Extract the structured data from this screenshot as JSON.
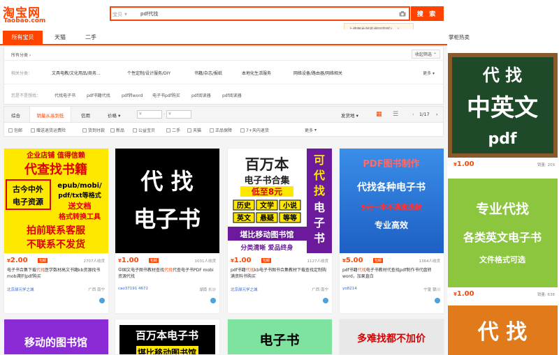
{
  "header": {
    "logo_cn": "淘宝网",
    "logo_en": "Taobao.com",
    "search_scope": "宝贝",
    "search_query": "pdf代找",
    "search_button": "搜 索",
    "tip": "上传图片就能搜同款啦!"
  },
  "tabs": [
    "所有宝贝",
    "天猫",
    "二手"
  ],
  "filters": {
    "all_categories": "所有分类",
    "collapse": "收起筛选",
    "category_label": "相关分类：",
    "categories": [
      "文具电教/文化用品/商务...",
      "个性定制/设计服务/DIY",
      "书籍/杂志/报纸",
      "本地化生活服务",
      "网络设备/路由器/网络相关"
    ],
    "more": "更多",
    "guess_label": "您是不是想找：",
    "guesses": [
      "代找电子书",
      "pdf书籍代找",
      "pdf转word",
      "电子书pdf购买",
      "pdf阅读器",
      "pdf阅读器"
    ]
  },
  "sort": {
    "options": [
      "综合",
      "销量从高到低",
      "信用",
      "价格"
    ],
    "price_from": "¥",
    "price_to": "¥",
    "ship_from": "发货地",
    "page": "1/17"
  },
  "checks": [
    "包邮",
    "赠送退货运费险",
    "货到付款",
    "新品",
    "公益宝贝",
    "二手",
    "天猫",
    "正品保障",
    "7+天内退货"
  ],
  "checks_more": "更多",
  "products": [
    {
      "img_lines": [
        "企业店铺 值得信赖",
        "代查找书籍",
        "古今中外",
        "电子资源",
        "epub/mobi/",
        "pdf/txt等格式",
        "送文档",
        "格式转换工具",
        "拍前联系客服",
        "不联系不发货"
      ],
      "price": "2.00",
      "badge": "包邮",
      "sold": "2707人收货",
      "title_pre": "电子书合集下载",
      "title_hl": "代找",
      "title_post": "医学数材高文书籍kb资源找书mobi期刊pdf购买",
      "shop": "北京颉元学之城",
      "loc": "广西 南宁"
    },
    {
      "img_lines": [
        "代 找",
        "电子书"
      ],
      "price": "1.00",
      "badge": "包邮",
      "sold": "1031人收货",
      "title_pre": "中国文电子图书教材查找",
      "title_hl": "代找",
      "title_post": "代查电子书PDF mobi资源代找",
      "shop": "cao37191 4672",
      "loc": "湖南 长沙"
    },
    {
      "img_lines": [
        "百万本",
        "电子书合集",
        "低至8元",
        "历史",
        "文学",
        "小说",
        "英文",
        "悬疑",
        "等等",
        "堪比移动图书馆",
        "分类清晰 爱品终身",
        "可",
        "代",
        "找",
        "电",
        "子",
        "书"
      ],
      "price": "1.00",
      "badge": "包邮",
      "sold": "1127人收货",
      "title_pre": "pdf书籍",
      "title_hl": "代找",
      "title_post": "kb电子书图书合集教材下载查找定制购满资料书购买",
      "shop": "北京颉元学之城",
      "loc": "广西 南宁"
    },
    {
      "img_lines": [
        "PDF图书制作",
        "代找各种电子书",
        "5元一本不满意退款",
        "专业高效"
      ],
      "price": "5.00",
      "badge": "包邮",
      "sold": "1364人收货",
      "title_pre": "pdf书籍",
      "title_hl": "代找",
      "title_post": "电子书教材代查找pdf制作书代盘转word，加果直白",
      "shop": "yo8214",
      "loc": "宁夏 银川"
    }
  ],
  "row2": [
    {
      "text": "移动的图书馆"
    },
    {
      "text": "百万本电子书",
      "sub": "堪比移动图书馆"
    },
    {
      "text": "电子书"
    },
    {
      "text": "多难找都不加价"
    }
  ],
  "sidebar": {
    "title": "掌柜热卖",
    "items": [
      {
        "lines": [
          "代 找",
          "中英文",
          "pdf"
        ],
        "price": "1.00",
        "sold": "销量: 209"
      },
      {
        "lines": [
          "专业代找",
          "各类英文电子书",
          "文件格式可选"
        ],
        "price": "1.00",
        "sold": "销量: 638"
      },
      {
        "lines": [
          "代 找"
        ],
        "price": "",
        "sold": ""
      }
    ]
  },
  "colors": {
    "accent": "#ff4400"
  }
}
